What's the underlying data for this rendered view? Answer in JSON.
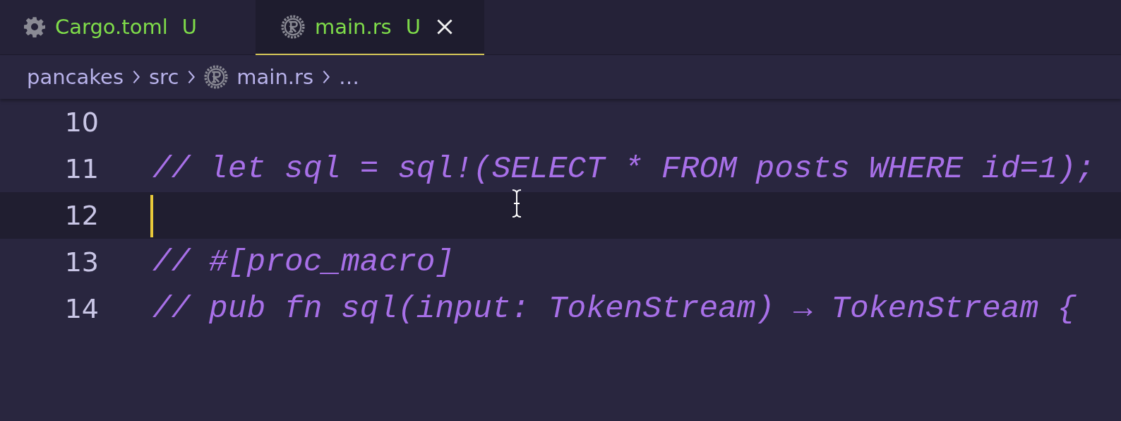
{
  "tabs": [
    {
      "label": "Cargo.toml",
      "badge": "U",
      "kind": "gear",
      "selected": false
    },
    {
      "label": "main.rs",
      "badge": "U",
      "kind": "rust",
      "selected": true
    }
  ],
  "breadcrumbs": [
    {
      "label": "pancakes",
      "kind": "plain"
    },
    {
      "label": "src",
      "kind": "plain"
    },
    {
      "label": "main.rs",
      "kind": "rust"
    },
    {
      "label": "…",
      "kind": "plain"
    }
  ],
  "editor": {
    "lines": [
      {
        "number": "10",
        "current": false
      },
      {
        "number": "11",
        "text": "// let sql = sql!(SELECT * FROM posts WHERE id=1);",
        "current": false
      },
      {
        "number": "12",
        "current": true
      },
      {
        "number": "13",
        "text": "// #[proc_macro]",
        "current": false
      },
      {
        "number": "14",
        "text": "// pub fn sql(input: TokenStream) → TokenStream {",
        "current": false
      }
    ]
  }
}
